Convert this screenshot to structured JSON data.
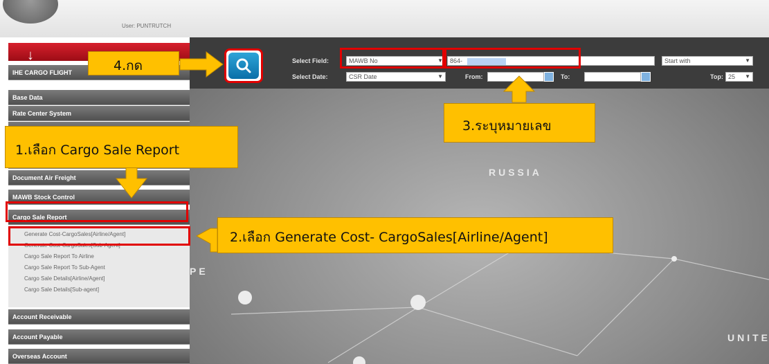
{
  "header": {
    "user_label": "User: PUNTRUTCH"
  },
  "sidebar": {
    "top_item": "IHE CARGO FLIGHT",
    "items": [
      "Base Data",
      "Rate Center System",
      "Document Air Freight",
      "MAWB Stock Control",
      "Cargo Sale Report",
      "Account Receivable",
      "Account Payable",
      "Overseas Account"
    ],
    "cargo_sale_sub_items": [
      "Generate Cost-CargoSales[Airline/Agent]",
      "Generate Cost-CargoSales[Sub-Agent]",
      "Cargo Sale Report To Airline",
      "Cargo Sale Report To Sub-Agent",
      "Cargo Sale Details[Airline/Agent]",
      "Cargo Sale Details[Sub-agent]"
    ]
  },
  "search": {
    "select_field_label": "Select Field:",
    "select_field_value": "MAWB No",
    "mawb_value": "864-",
    "match_mode": "Start with",
    "select_date_label": "Select Date:",
    "select_date_value": "CSR Date",
    "from_label": "From:",
    "to_label": "To:",
    "top_label": "Top:",
    "top_value": "25"
  },
  "map": {
    "labels": [
      "RUSSIA",
      "UNITE",
      "PE"
    ]
  },
  "callouts": {
    "step1": "1.เลือก Cargo Sale Report",
    "step2": "2.เลือก Generate Cost- CargoSales[Airline/Agent]",
    "step3": "3.ระบุหมายเลข",
    "step4": "4.กด"
  },
  "colors": {
    "callout": "#ffc000",
    "highlight_border": "#e10000",
    "menu_red": "#c8141f",
    "search_button": "#1e8fc8"
  },
  "icons": {
    "search_button": "magnifier-icon",
    "collapse": "arrow-down-icon"
  }
}
